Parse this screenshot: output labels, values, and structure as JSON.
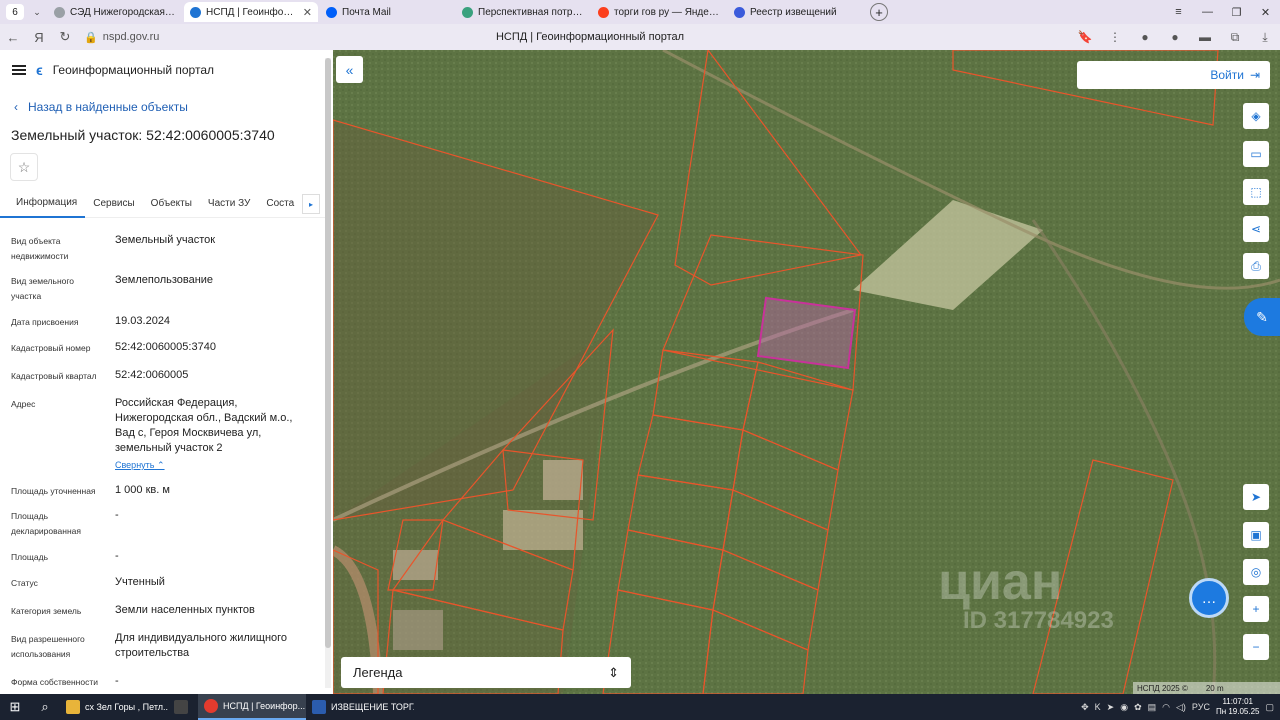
{
  "browser": {
    "tab_count": "6",
    "tabs": [
      {
        "label": "СЭД Нижегородская обл",
        "color": "#9aa0a6"
      },
      {
        "label": "НСПД | Геоинформац",
        "color": "#1f74d3",
        "active": true
      },
      {
        "label": "Почта Mail",
        "color": "#005ff9"
      },
      {
        "label": "Перспективная потребн",
        "color": "#3aa17e"
      },
      {
        "label": "торги гов ру — Яндекс: н",
        "color": "#fc3f1d"
      },
      {
        "label": "Реестр извещений",
        "color": "#3b5bdb"
      }
    ],
    "url": "nspd.gov.ru",
    "page_title": "НСПД | Геоинформационный портал"
  },
  "sidebar": {
    "portal_name": "Геоинформационный портал",
    "back_link": "Назад в найденные объекты",
    "object_title": "Земельный участок: 52:42:0060005:3740",
    "tabs": [
      "Информация",
      "Сервисы",
      "Объекты",
      "Части ЗУ",
      "Соста"
    ],
    "properties": [
      {
        "label": "Вид объекта недвижимости",
        "value": "Земельный участок"
      },
      {
        "label": "Вид земельного участка",
        "value": "Землепользование"
      },
      {
        "label": "Дата присвоения",
        "value": "19.03.2024"
      },
      {
        "label": "Кадастровый номер",
        "value": "52:42:0060005:3740"
      },
      {
        "label": "Кадастровый квартал",
        "value": "52:42:0060005"
      },
      {
        "label": "Адрес",
        "value": "Российская Федерация, Нижегородская обл., Вадский м.о., Вад с, Героя Москвичева ул, земельный участок 2"
      },
      {
        "label": "Площадь уточненная",
        "value": "1 000 кв. м"
      },
      {
        "label": "Площадь декларированная",
        "value": "-"
      },
      {
        "label": "Площадь",
        "value": "-"
      },
      {
        "label": "Статус",
        "value": "Учтенный"
      },
      {
        "label": "Категория земель",
        "value": "Земли населенных пунктов"
      },
      {
        "label": "Вид разрешенного использования",
        "value": "Для индивидуального жилищного строительства"
      },
      {
        "label": "Форма собственности",
        "value": "-"
      }
    ],
    "collapse_label": "Свернуть"
  },
  "map": {
    "login_label": "Войти",
    "legend_label": "Легенда",
    "watermark_brand": "циан",
    "watermark_id": "ID 317784923",
    "copyright": "НСПД 2025 ©",
    "scale": "20 m",
    "colors": {
      "parcel_outline": "#e8552b",
      "selected_outline": "#c8329a"
    }
  },
  "taskbar": {
    "apps": [
      {
        "label": "сх Зел Горы , Петл...",
        "color": "#e8b43a"
      },
      {
        "label": "",
        "color": "#444"
      },
      {
        "label": "НСПД | Геоинфор...",
        "color": "#e33b2e",
        "active": true
      },
      {
        "label": "ИЗВЕЩЕНИЕ ТОРГ...",
        "color": "#2b5cad"
      }
    ],
    "lang": "РУС",
    "time": "11:07:01",
    "date": "Пн 19.05.25"
  }
}
